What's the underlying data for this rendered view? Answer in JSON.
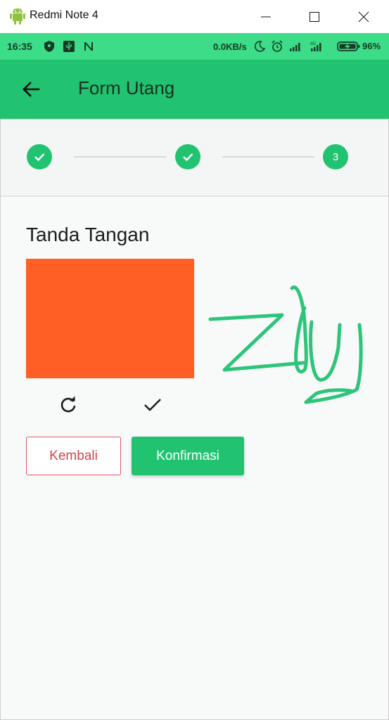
{
  "window": {
    "title": "Redmi Note 4"
  },
  "status_bar": {
    "time": "16:35",
    "net_speed": "0.0KB/s",
    "battery": "96%",
    "icons": [
      "shield-icon",
      "usb-icon",
      "n-icon",
      "moon-icon",
      "alarm-icon",
      "signal-icon",
      "signal-4g-icon",
      "battery-charging-icon"
    ]
  },
  "app_bar": {
    "title": "Form Utang",
    "back_icon": "arrow-left-icon"
  },
  "stepper": {
    "steps": [
      {
        "state": "completed",
        "icon": "check-icon"
      },
      {
        "state": "completed",
        "icon": "check-icon"
      },
      {
        "state": "active",
        "label": "3"
      }
    ]
  },
  "signature_section": {
    "title": "Tanda Tangan",
    "pad_color": "#ff5f24",
    "reset_icon": "refresh-icon",
    "confirm_icon": "check-icon",
    "stroke_color": "#2ec47a"
  },
  "actions": {
    "back_label": "Kembali",
    "confirm_label": "Konfirmasi"
  },
  "colors": {
    "primary": "#21c370",
    "status_bar": "#3ddc88",
    "danger": "#d8434f"
  }
}
